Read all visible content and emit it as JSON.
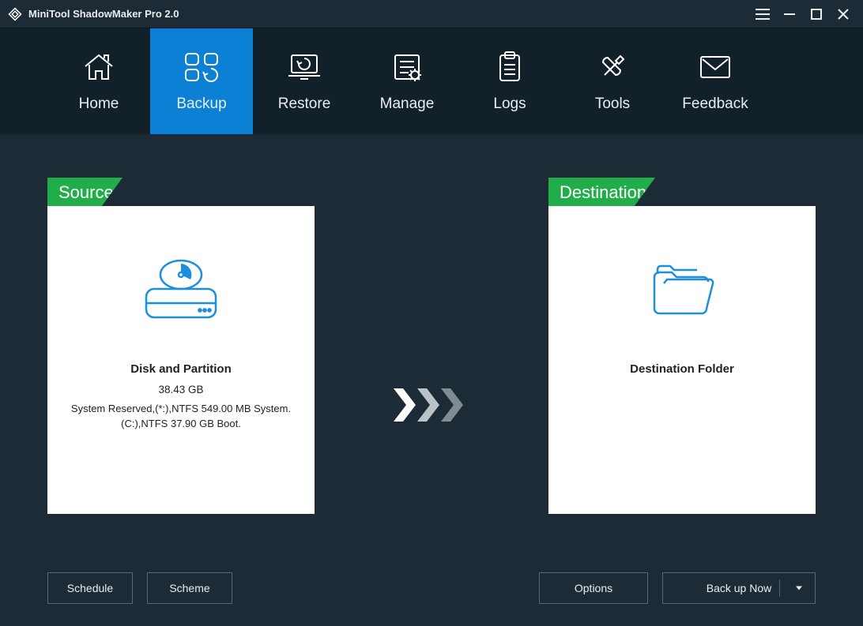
{
  "app": {
    "title": "MiniTool ShadowMaker Pro 2.0"
  },
  "nav": {
    "home": {
      "label": "Home"
    },
    "backup": {
      "label": "Backup"
    },
    "restore": {
      "label": "Restore"
    },
    "manage": {
      "label": "Manage"
    },
    "logs": {
      "label": "Logs"
    },
    "tools": {
      "label": "Tools"
    },
    "feedback": {
      "label": "Feedback"
    }
  },
  "source": {
    "tab": "Source",
    "caption": "Disk and Partition",
    "size": "38.43 GB",
    "details": "System Reserved,(*:),NTFS 549.00 MB System. (C:),NTFS 37.90 GB Boot."
  },
  "destination": {
    "tab": "Destination",
    "caption": "Destination Folder"
  },
  "buttons": {
    "schedule": "Schedule",
    "scheme": "Scheme",
    "options": "Options",
    "backup_now": "Back up Now"
  }
}
